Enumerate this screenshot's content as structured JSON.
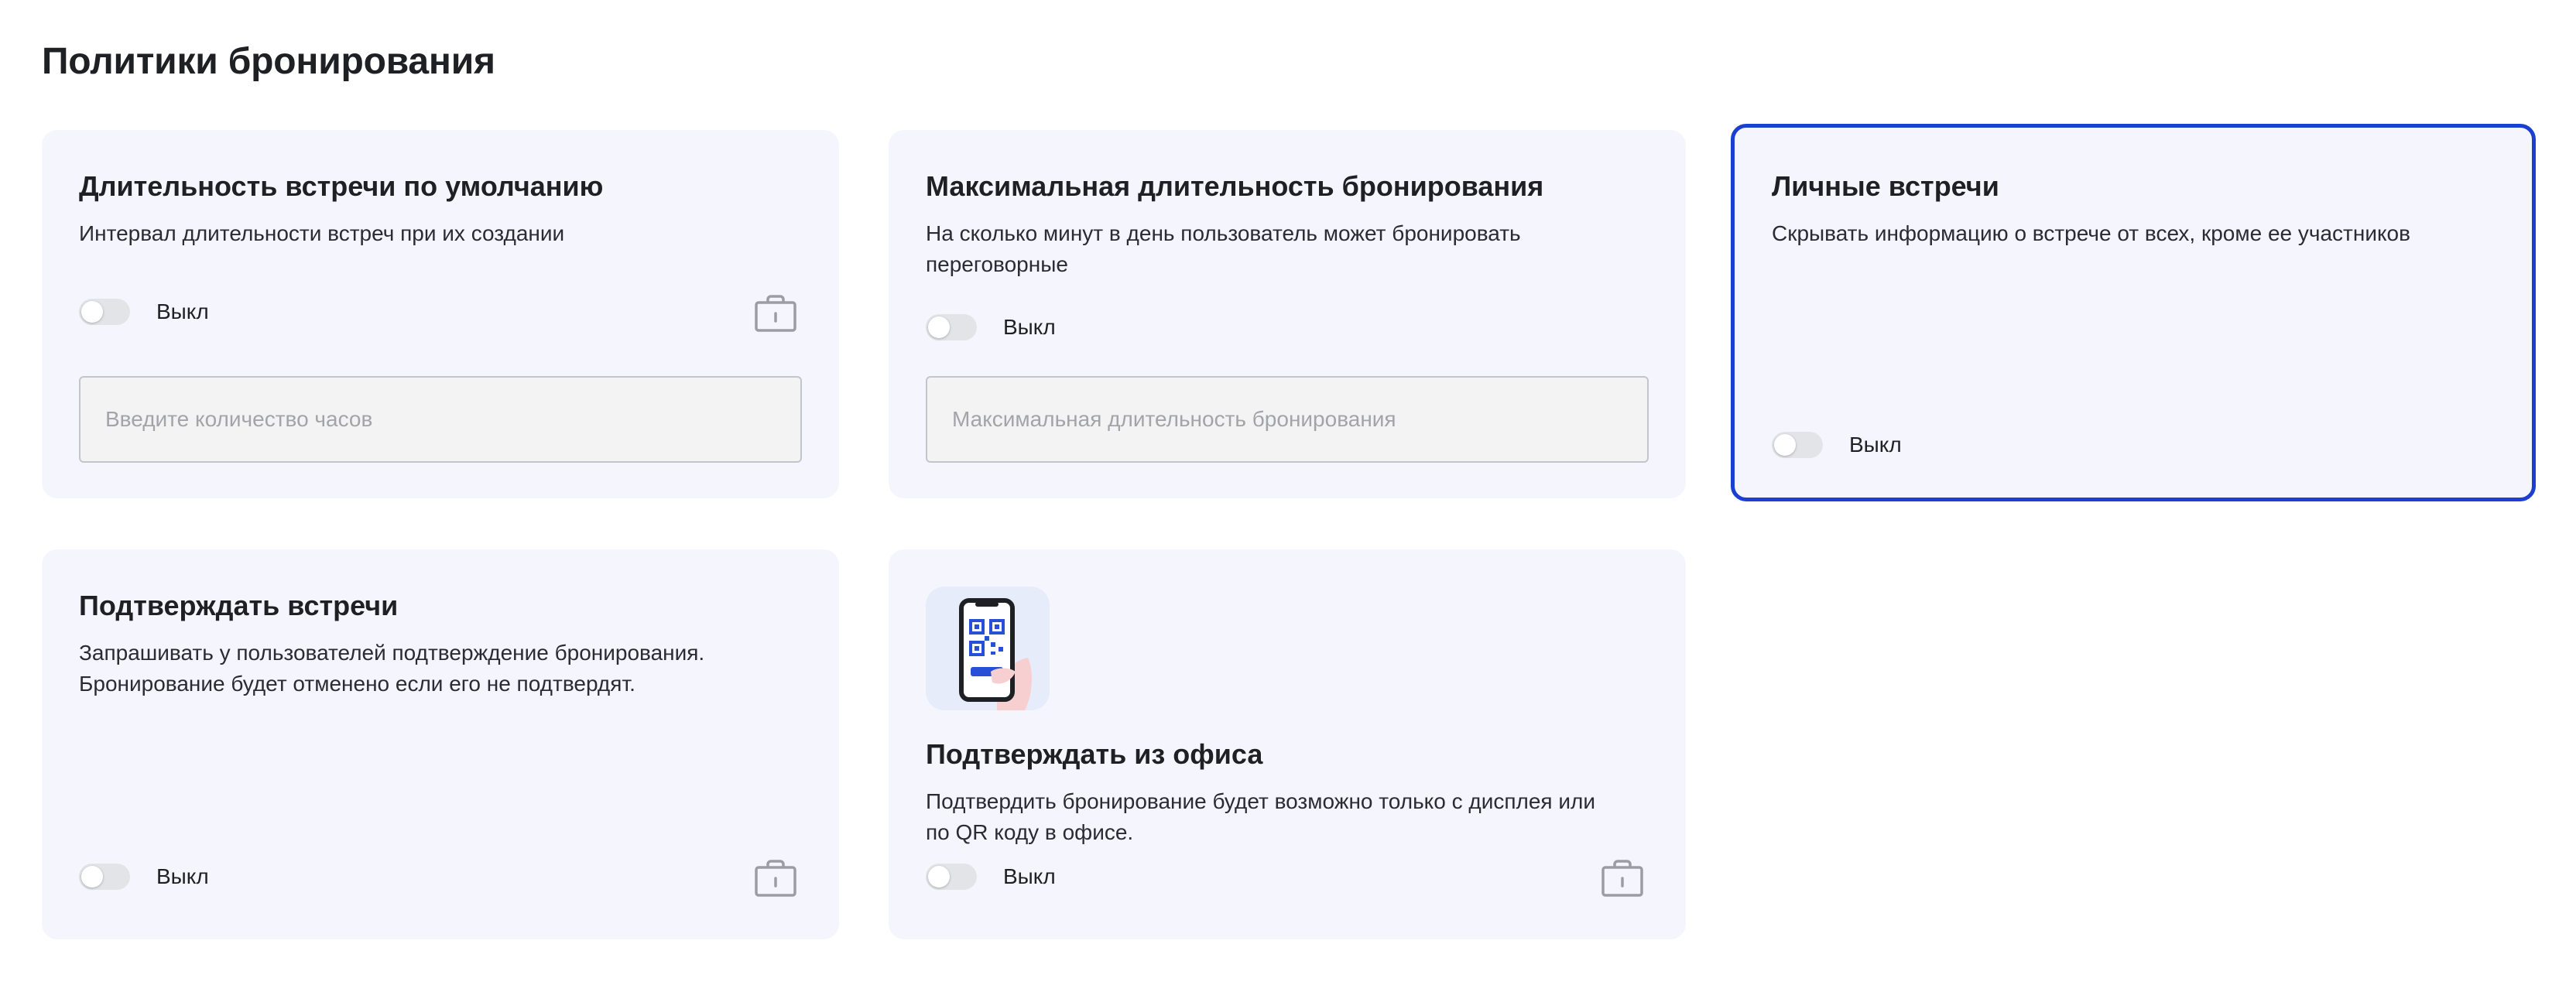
{
  "page": {
    "title": "Политики бронирования"
  },
  "cards": {
    "default_duration": {
      "title": "Длительность встречи по умолчанию",
      "description": "Интервал длительности встреч при их создании",
      "toggle_label": "Выкл",
      "toggle_on": false,
      "locked": true,
      "input_placeholder": "Введите количество часов",
      "input_value": ""
    },
    "max_duration": {
      "title": "Максимальная длительность бронирования",
      "description_line1": "На сколько минут в день пользователь может бронировать",
      "description_line2": "переговорные",
      "toggle_label": "Выкл",
      "toggle_on": false,
      "input_placeholder": "Максимальная длительность бронирования",
      "input_value": ""
    },
    "private_meetings": {
      "title": "Личные встречи",
      "description": "Скрывать информацию о встрече от всех, кроме ее участников",
      "toggle_label": "Выкл",
      "toggle_on": false,
      "selected": true
    },
    "confirm_meetings": {
      "title": "Подтверждать встречи",
      "description_line1": "Запрашивать у пользователей подтверждение бронирования.",
      "description_line2": "Бронирование будет отменено если его не подтвердят.",
      "toggle_label": "Выкл",
      "toggle_on": false,
      "locked": true
    },
    "confirm_from_office": {
      "title": "Подтверждать из офиса",
      "description_line1": "Подтвердить бронирование будет возможно только с дисплея или",
      "description_line2": "по QR коду в офисе.",
      "toggle_label": "Выкл",
      "toggle_on": false,
      "locked": true,
      "illustration_icon": "phone-qr-icon"
    }
  },
  "colors": {
    "card_bg": "#f5f6fd",
    "selected_border": "#1a3fd1",
    "toggle_off": "#e3e4e8",
    "lock_icon": "#9c9da3"
  }
}
